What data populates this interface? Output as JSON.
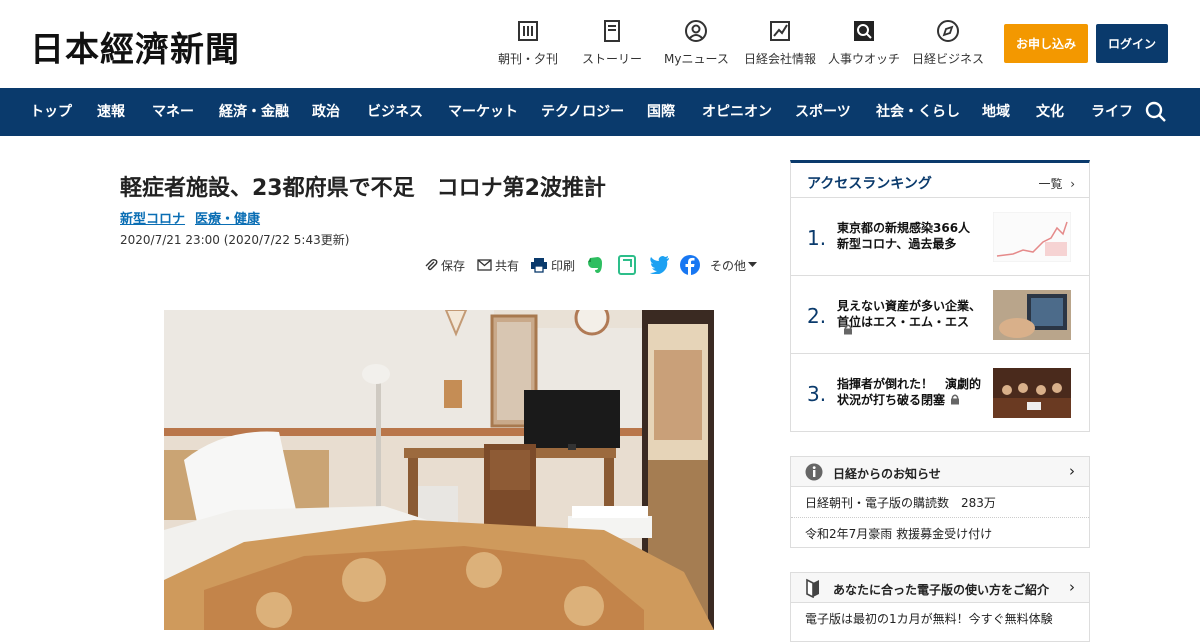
{
  "header": {
    "logo": "日本經濟新聞",
    "services": [
      {
        "label": "朝刊・夕刊",
        "icon": "newspaper-icon"
      },
      {
        "label": "ストーリー",
        "icon": "document-icon"
      },
      {
        "label": "Myニュース",
        "icon": "user-icon"
      },
      {
        "label": "日経会社情報",
        "icon": "chart-search-icon"
      },
      {
        "label": "人事ウオッチ",
        "icon": "magnifier-icon"
      },
      {
        "label": "日経ビジネス",
        "icon": "compass-icon"
      }
    ],
    "apply_label": "お申し込み",
    "login_label": "ログイン"
  },
  "nav": {
    "items": [
      "トップ",
      "速報",
      "マネー",
      "経済・金融",
      "政治",
      "ビジネス",
      "マーケット",
      "テクノロジー",
      "国際",
      "オピニオン",
      "スポーツ",
      "社会・くらし",
      "地域",
      "文化",
      "ライフ"
    ]
  },
  "article": {
    "headline": "軽症者施設、23都府県で不足　コロナ第2波推計",
    "tags": [
      "新型コロナ",
      "医療・健康"
    ],
    "date": "2020/7/21 23:00 (2020/7/22 5:43更新)",
    "share": {
      "save": "保存",
      "share": "共有",
      "print": "印刷",
      "more": "その他"
    }
  },
  "sidebar": {
    "ranking": {
      "title": "アクセスランキング",
      "more": "一覧",
      "items": [
        {
          "rank": "1.",
          "text": "東京都の新規感染366人　新型コロナ、過去最多"
        },
        {
          "rank": "2.",
          "text": "見えない資産が多い企業、首位はエス・エム・エス"
        },
        {
          "rank": "3.",
          "text": "指揮者が倒れた！　演劇的状況が打ち破る閉塞"
        }
      ]
    },
    "notice": {
      "title": "日経からのお知らせ",
      "rows": [
        "日経朝刊・電子版の購読数　283万",
        "令和2年7月豪雨 救援募金受け付け"
      ]
    },
    "guide": {
      "title": "あなたに合った電子版の使い方をご紹介",
      "row": "電子版は最初の1カ月が無料！今すぐ無料体験"
    }
  },
  "colors": {
    "navy": "#0a3a6c",
    "orange": "#f39800",
    "link": "#0a6eb4"
  }
}
